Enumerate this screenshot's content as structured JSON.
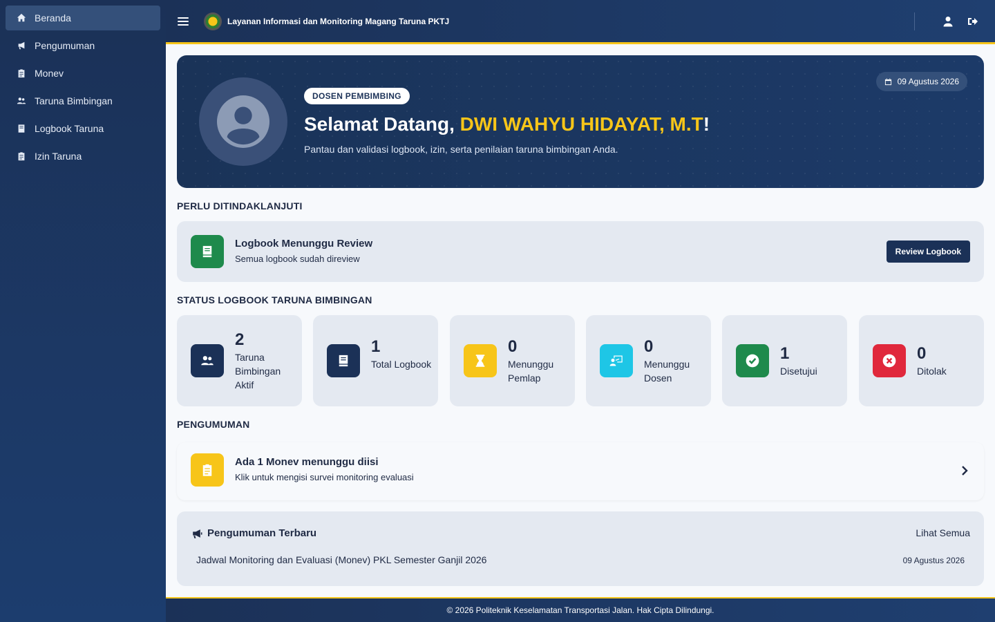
{
  "sidebar": {
    "items": [
      {
        "label": "Beranda",
        "icon": "home-icon"
      },
      {
        "label": "Pengumuman",
        "icon": "megaphone-icon"
      },
      {
        "label": "Monev",
        "icon": "clipboard-icon"
      },
      {
        "label": "Taruna Bimbingan",
        "icon": "users-icon"
      },
      {
        "label": "Logbook Taruna",
        "icon": "book-icon"
      },
      {
        "label": "Izin Taruna",
        "icon": "clipboard-list-icon"
      }
    ]
  },
  "header": {
    "title": "Layanan Informasi dan Monitoring Magang Taruna PKTJ"
  },
  "hero": {
    "role": "DOSEN PEMBIMBING",
    "greeting": "Selamat Datang, ",
    "name": "DWI WAHYU HIDAYAT, M.T",
    "exclaim": "!",
    "subtitle": "Pantau dan validasi logbook, izin, serta penilaian taruna bimbingan Anda.",
    "date": "09 Agustus 2026"
  },
  "action_section": {
    "title": "PERLU DITINDAKLANJUTI",
    "card_title": "Logbook Menunggu Review",
    "card_sub": "Semua logbook sudah direview",
    "button": "Review Logbook"
  },
  "status_section": {
    "title": "STATUS LOGBOOK TARUNA BIMBINGAN",
    "stats": [
      {
        "value": "2",
        "label": "Taruna Bimbingan Aktif",
        "color": "#1b3157",
        "icon": "users-icon"
      },
      {
        "value": "1",
        "label": "Total Logbook",
        "color": "#1b3157",
        "icon": "book-icon"
      },
      {
        "value": "0",
        "label": "Menunggu Pemlap",
        "color": "#f7c519",
        "icon": "hourglass-icon"
      },
      {
        "value": "0",
        "label": "Menunggu Dosen",
        "color": "#1ec6e6",
        "icon": "teacher-icon"
      },
      {
        "value": "1",
        "label": "Disetujui",
        "color": "#1e8a4c",
        "icon": "check-circle-icon"
      },
      {
        "value": "0",
        "label": "Ditolak",
        "color": "#e0283c",
        "icon": "x-circle-icon"
      }
    ]
  },
  "announce_section": {
    "title": "PENGUMUMAN",
    "notice_title": "Ada 1 Monev menunggu diisi",
    "notice_sub": "Klik untuk mengisi survei monitoring evaluasi"
  },
  "latest": {
    "title": "Pengumuman Terbaru",
    "see_all": "Lihat Semua",
    "item_title": "Jadwal Monitoring dan Evaluasi (Monev) PKL Semester Ganjil 2026",
    "item_date": "09 Agustus 2026"
  },
  "footer": {
    "text": "© 2026 Politeknik Keselamatan Transportasi Jalan. Hak Cipta Dilindungi."
  }
}
